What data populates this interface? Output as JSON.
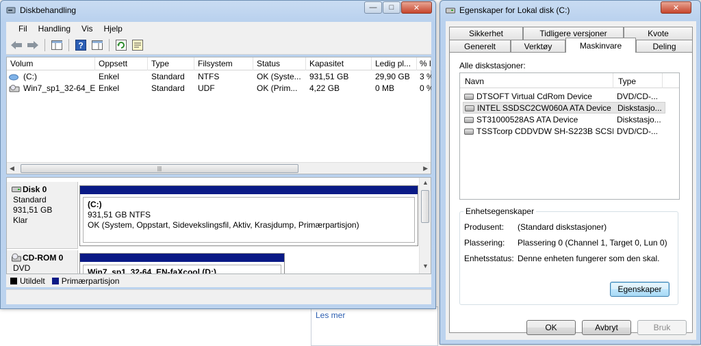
{
  "background": {
    "link_text": "Les mer"
  },
  "disk_window": {
    "title": "Diskbehandling",
    "menu": [
      "Fil",
      "Handling",
      "Vis",
      "Hjelp"
    ],
    "columns": [
      "Volum",
      "Oppsett",
      "Type",
      "Filsystem",
      "Status",
      "Kapasitet",
      "Ledig pl...",
      "% l"
    ],
    "rows": [
      {
        "volume": "(C:)",
        "layout": "Enkel",
        "type": "Standard",
        "fs": "NTFS",
        "status": "OK (Syste...",
        "capacity": "931,51 GB",
        "free": "29,90 GB",
        "pct": "3 %"
      },
      {
        "volume": "Win7_sp1_32-64_E...",
        "layout": "Enkel",
        "type": "Standard",
        "fs": "UDF",
        "status": "OK (Prim...",
        "capacity": "4,22 GB",
        "free": "0 MB",
        "pct": "0 %"
      }
    ],
    "disks": [
      {
        "name": "Disk 0",
        "kind": "Standard",
        "size": "931,51 GB",
        "state": "Klar",
        "partition_title": "(C:)",
        "partition_size": "931,51 GB NTFS",
        "partition_status": "OK (System, Oppstart, Sidevekslingsfil, Aktiv, Krasjdump, Primærpartisjon)"
      },
      {
        "name": "CD-ROM 0",
        "kind": "DVD",
        "partition_title": "Win7_sp1_32-64_EN-faXcool  (D:)"
      }
    ],
    "legend": {
      "unallocated": "Utildelt",
      "primary": "Primærpartisjon",
      "unallocated_color": "#000000",
      "primary_color": "#0a1a86"
    }
  },
  "props_dialog": {
    "title": "Egenskaper for Lokal disk (C:)",
    "tabs_row1": [
      "Sikkerhet",
      "Tidligere versjoner",
      "Kvote"
    ],
    "tabs_row2": [
      "Generelt",
      "Verktøy",
      "Maskinvare",
      "Deling"
    ],
    "active_tab": "Maskinvare",
    "all_drives_label": "Alle diskstasjoner:",
    "list_columns": [
      "Navn",
      "Type"
    ],
    "drives": [
      {
        "name": "DTSOFT Virtual CdRom Device",
        "type": "DVD/CD-..."
      },
      {
        "name": "INTEL SSDSC2CW060A ATA Device",
        "type": "Diskstasjo..."
      },
      {
        "name": "ST31000528AS ATA Device",
        "type": "Diskstasjo..."
      },
      {
        "name": "TSSTcorp CDDVDW SH-S223B SCSI ...",
        "type": "DVD/CD-..."
      }
    ],
    "device_props_title": "Enhetsegenskaper",
    "manufacturer_label": "Produsent:",
    "manufacturer_value": "(Standard diskstasjoner)",
    "location_label": "Plassering:",
    "location_value": "Plassering 0 (Channel 1, Target 0, Lun 0)",
    "status_label": "Enhetsstatus:",
    "status_value": "Denne enheten fungerer som den skal.",
    "properties_button": "Egenskaper",
    "ok_button": "OK",
    "cancel_button": "Avbryt",
    "apply_button": "Bruk"
  }
}
